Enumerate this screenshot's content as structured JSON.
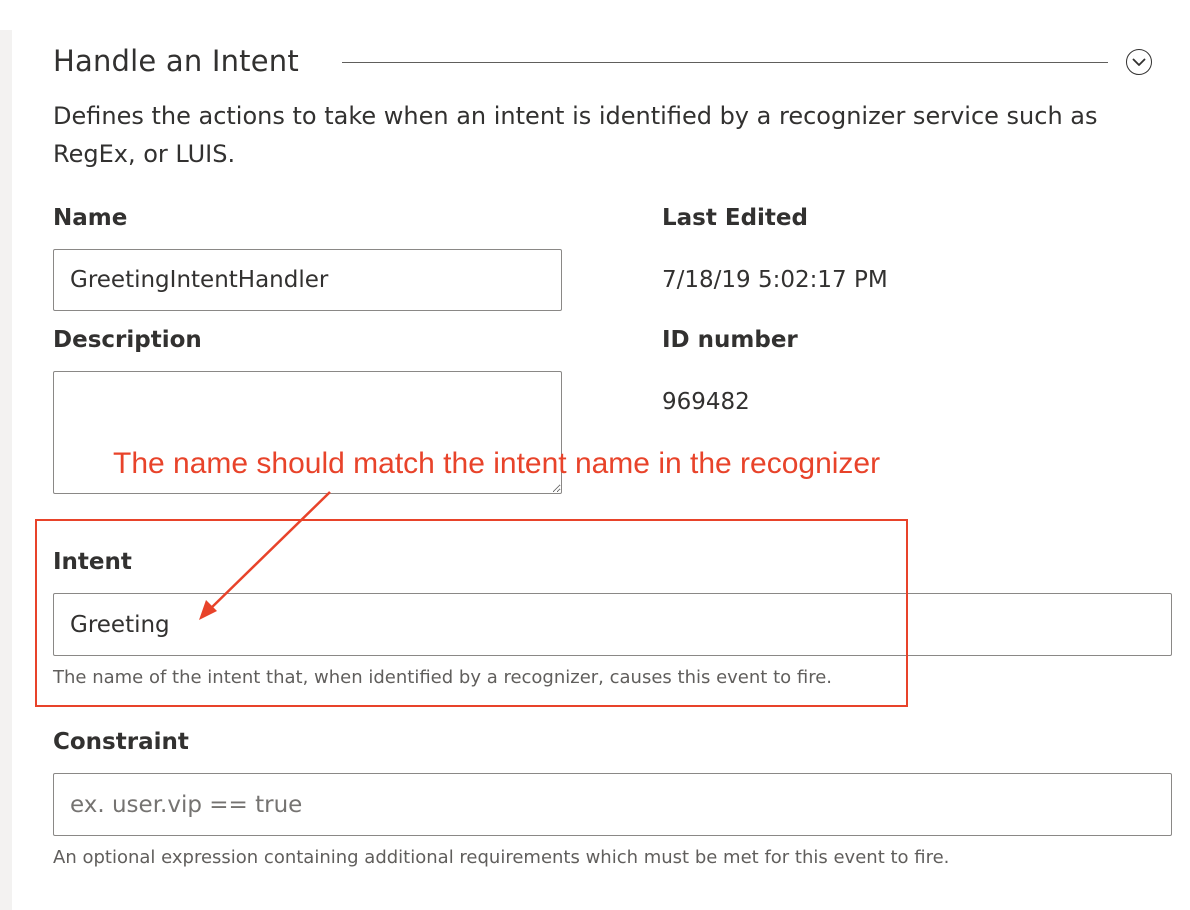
{
  "header": {
    "title": "Handle an Intent",
    "description": "Defines the actions to take when an intent is identified by a recognizer service such as RegEx, or LUIS.",
    "collapse_icon": "chevron-down-circle-icon"
  },
  "fields": {
    "name": {
      "label": "Name",
      "value": "GreetingIntentHandler"
    },
    "description": {
      "label": "Description",
      "value": ""
    },
    "last_edited": {
      "label": "Last Edited",
      "value": "7/18/19 5:02:17 PM"
    },
    "id_number": {
      "label": "ID number",
      "value": "969482"
    },
    "intent": {
      "label": "Intent",
      "value": "Greeting",
      "help": "The name of the intent that, when identified by a recognizer, causes this event to fire."
    },
    "constraint": {
      "label": "Constraint",
      "value": "",
      "placeholder": "ex. user.vip == true",
      "help": "An optional expression containing additional requirements which must be met for this event to fire."
    }
  },
  "annotation": {
    "text": "The name should match the intent name in the recognizer",
    "color": "#e8432a"
  }
}
